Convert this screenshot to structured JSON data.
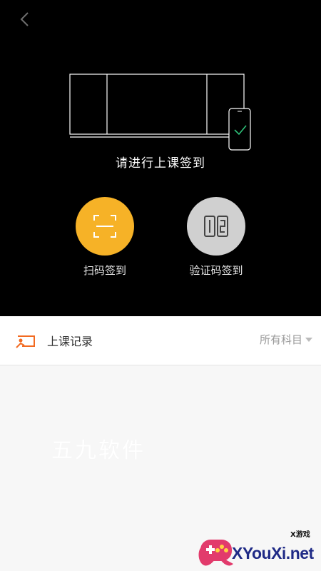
{
  "header": {
    "back_icon": "chevron-left-icon"
  },
  "hero": {
    "prompt": "请进行上课签到",
    "illustration_icon": "blackboard-phone-check-icon"
  },
  "signin_options": [
    {
      "label": "扫码签到",
      "icon": "scan-frame-icon",
      "color": "#f6b227"
    },
    {
      "label": "验证码签到",
      "icon": "code-digits-icon",
      "color": "#d0d0d0"
    }
  ],
  "records": {
    "title": "上课记录",
    "icon": "class-board-icon",
    "icon_color": "#f26a21",
    "filter_label": "所有科目"
  },
  "watermarks": {
    "text": "五九软件",
    "logo_text": "XYouXi.net",
    "logo_small": "X游戏"
  }
}
